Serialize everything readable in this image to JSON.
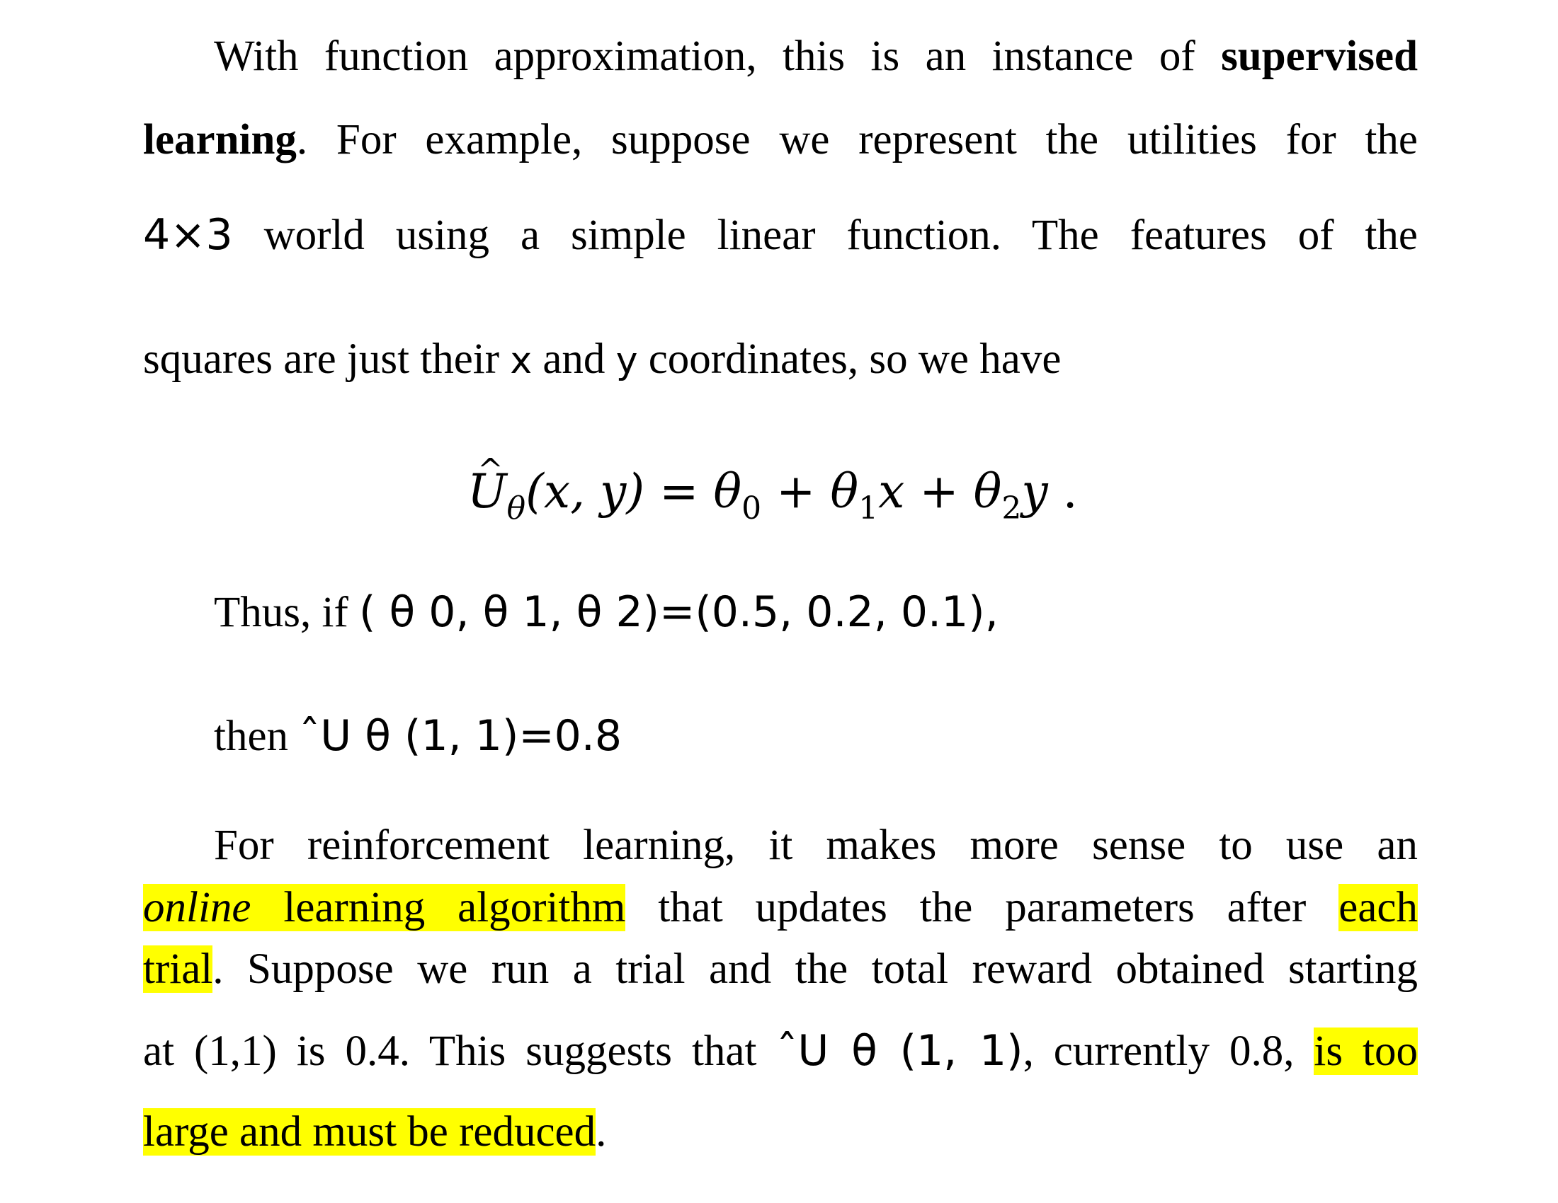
{
  "paragraph1": {
    "line1_text": "With function approximation, this is an instance of ",
    "line1_bold": "supervised",
    "line2_bold": "learning",
    "line2_text": ". For example, suppose we represent the utilities for the",
    "line3_math": "4×3",
    "line3_text": " world using a simple linear function. The features of the",
    "line4_text_a": "squares are just their ",
    "line4_x": "x",
    "line4_text_b": " and ",
    "line4_y": "y",
    "line4_text_c": " coordinates, so we have"
  },
  "formula": {
    "lhs": "U",
    "lhs_sub": "θ",
    "lhs_args": "(x, y)",
    "equals": " = ",
    "t0": "θ",
    "t0_sub": "0",
    "plus1": " + ",
    "t1": "θ",
    "t1_sub": "1",
    "t1_var": "x",
    "plus2": " + ",
    "t2": "θ",
    "t2_sub": "2",
    "t2_var": "y",
    "end": " ."
  },
  "thus_line": {
    "serif": "Thus, if ",
    "sans": "( θ 0, θ 1, θ 2)=(0.5, 0.2, 0.1),"
  },
  "then_line": {
    "serif": "then ",
    "sans": "ˆU  θ (1, 1)=0.8"
  },
  "paragraph2": {
    "line1": "For reinforcement learning, it makes more sense to use an",
    "line2_hl_italic": "online",
    "line2_hl_text": " learning algorithm",
    "line2_text": " that updates the parameters after ",
    "line2_hl_end": "each",
    "line3_hl": "trial",
    "line3_text": ". Suppose we run a trial and the total reward obtained starting",
    "line4_text_a": "at (1,1) is 0.4. This suggests that ",
    "line4_sans": "ˆU  θ (1, 1)",
    "line4_text_b": ", currently 0.8, ",
    "line4_hl": "is too",
    "line5_hl": "large and must be reduced",
    "line5_text": "."
  },
  "highlight_color": "#ffff00"
}
